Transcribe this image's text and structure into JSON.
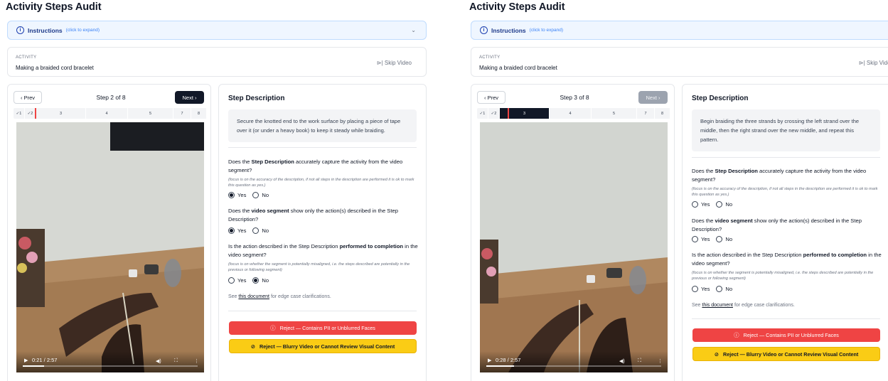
{
  "panels": [
    {
      "title": "Activity Steps Audit",
      "instructions": {
        "label": "Instructions",
        "hint": "(click to expand)"
      },
      "activity": {
        "label": "ACTIVITY",
        "name": "Making a braided cord bracelet",
        "skip": "Skip Video"
      },
      "nav": {
        "prev": "Prev",
        "step": "Step 2 of 8",
        "next": "Next",
        "next_disabled": false
      },
      "timeline": {
        "segments": [
          "✓1",
          "✓2",
          "3",
          "4",
          "5",
          "7",
          "8"
        ],
        "active_index": 1
      },
      "video": {
        "time": "0:21 / 2:57",
        "progress": 0.12
      },
      "step_description": {
        "title": "Step Description",
        "text": "Secure the knotted end to the work surface by placing a piece of tape over it (or under a heavy book) to keep it steady while braiding."
      },
      "q1": {
        "pre": "Does the ",
        "bold": "Step Description",
        "post": " accurately capture the activity from the video segment?",
        "note": "(focus is on the accuracy of the description, if not all steps in the description are performed it is ok to mark this question as yes.)",
        "yes": "Yes",
        "no": "No",
        "selected": "yes"
      },
      "q2": {
        "pre": "Does the ",
        "bold": "video segment",
        "post": " show only the action(s) described in the Step Description?",
        "yes": "Yes",
        "no": "No",
        "selected": "yes"
      },
      "q3": {
        "pre": "Is the action described in the Step Description ",
        "bold": "performed to completion",
        "post": " in the video segment?",
        "note": "(focus is on whether the segment is potentially misaligned, i.e. the steps described are potentially in the previous or following segment)",
        "yes": "Yes",
        "no": "No",
        "selected": "no"
      },
      "see": {
        "pre": "See ",
        "link": "this document",
        "post": " for edge case clarifications."
      },
      "reject_pii": "Reject — Contains PII or Unblurred Faces",
      "reject_blurry": "Reject — Blurry Video or Cannot Review Visual Content"
    },
    {
      "title": "Activity Steps Audit",
      "instructions": {
        "label": "Instructions",
        "hint": "(click to expand)"
      },
      "activity": {
        "label": "ACTIVITY",
        "name": "Making a braided cord bracelet",
        "skip": "Skip Video"
      },
      "nav": {
        "prev": "Prev",
        "step": "Step 3 of 8",
        "next": "Next",
        "next_disabled": true
      },
      "timeline": {
        "segments": [
          "✓1",
          "✓2",
          "3",
          "4",
          "5",
          "7",
          "8"
        ],
        "active_index": 2
      },
      "video": {
        "time": "0:28 / 2:57",
        "progress": 0.16
      },
      "step_description": {
        "title": "Step Description",
        "text": "Begin braiding the three strands by crossing the left strand over the middle, then the right strand over the new middle, and repeat this pattern."
      },
      "q1": {
        "pre": "Does the ",
        "bold": "Step Description",
        "post": " accurately capture the activity from the video segment?",
        "note": "(focus is on the accuracy of the description, if not all steps in the description are performed it is ok to mark this question as yes.)",
        "yes": "Yes",
        "no": "No",
        "selected": "none"
      },
      "q2": {
        "pre": "Does the ",
        "bold": "video segment",
        "post": " show only the action(s) described in the Step Description?",
        "yes": "Yes",
        "no": "No",
        "selected": "none"
      },
      "q3": {
        "pre": "Is the action described in the Step Description ",
        "bold": "performed to completion",
        "post": " in the video segment?",
        "note": "(focus is on whether the segment is potentially misaligned, i.e. the steps described are potentially in the previous or following segment)",
        "yes": "Yes",
        "no": "No",
        "selected": "none"
      },
      "see": {
        "pre": "See ",
        "link": "this document",
        "post": " for edge case clarifications."
      },
      "reject_pii": "Reject — Contains PII or Unblurred Faces",
      "reject_blurry": "Reject — Blurry Video or Cannot Review Visual Content"
    }
  ],
  "colors": {
    "accent": "#111827",
    "reject_red": "#ef4444",
    "reject_yellow": "#facc15",
    "info_blue": "#eff6ff"
  },
  "icons": {
    "info": "info-icon",
    "chevron": "chevron-down-icon",
    "skip": "skip-icon",
    "alert": "alert-icon",
    "eye_off": "eye-off-icon"
  }
}
